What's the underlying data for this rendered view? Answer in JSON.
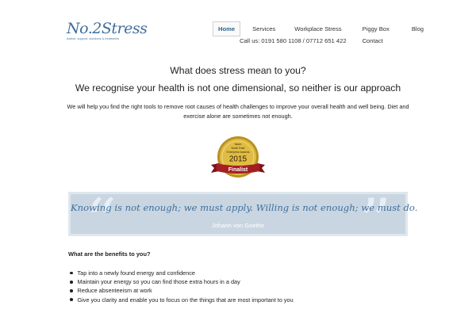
{
  "brand": {
    "logo_text": "No.2Stress",
    "tagline": "Advice, support, solutions & treatments"
  },
  "nav": {
    "items": [
      {
        "label": "Home",
        "active": true
      },
      {
        "label": "Services"
      },
      {
        "label": "Workplace Stress"
      },
      {
        "label": "Piggy Box"
      },
      {
        "label": "Blog"
      }
    ],
    "phone": "Call us: 0191 580 1108 / 07712 651 422",
    "contact": "Contact"
  },
  "main": {
    "heading": "What does stress mean to you?",
    "subheading": "We recognise your health is not one dimensional, so neither is our approach",
    "intro": "We will help you find the right tools to remove root causes of health challenges to improve your overall health and well being.  Diet and exercise alone are sometimes not enough."
  },
  "award": {
    "line1": "Isaon",
    "line2": "North East",
    "line3": "Enterprise Awards",
    "year": "2015",
    "ribbon": "Finalist",
    "colors": {
      "gold": "#c9a227",
      "ribbon": "#a31f24"
    }
  },
  "quote": {
    "text": "Knowing is not enough; we must apply. Willing is not enough; we must do.",
    "author": "Johann von Goethe",
    "colors": {
      "background": "#c9d6e1",
      "text": "#3f6f9e"
    }
  },
  "benefits": {
    "title": "What are the benefits to you?",
    "items": [
      "Tap into a newly found energy and confidence",
      "Maintain your energy so you can find those extra hours in a day",
      "Reduce absenteeism at work",
      "Give you clarity and enable you to focus on the things that are most important to you"
    ]
  }
}
